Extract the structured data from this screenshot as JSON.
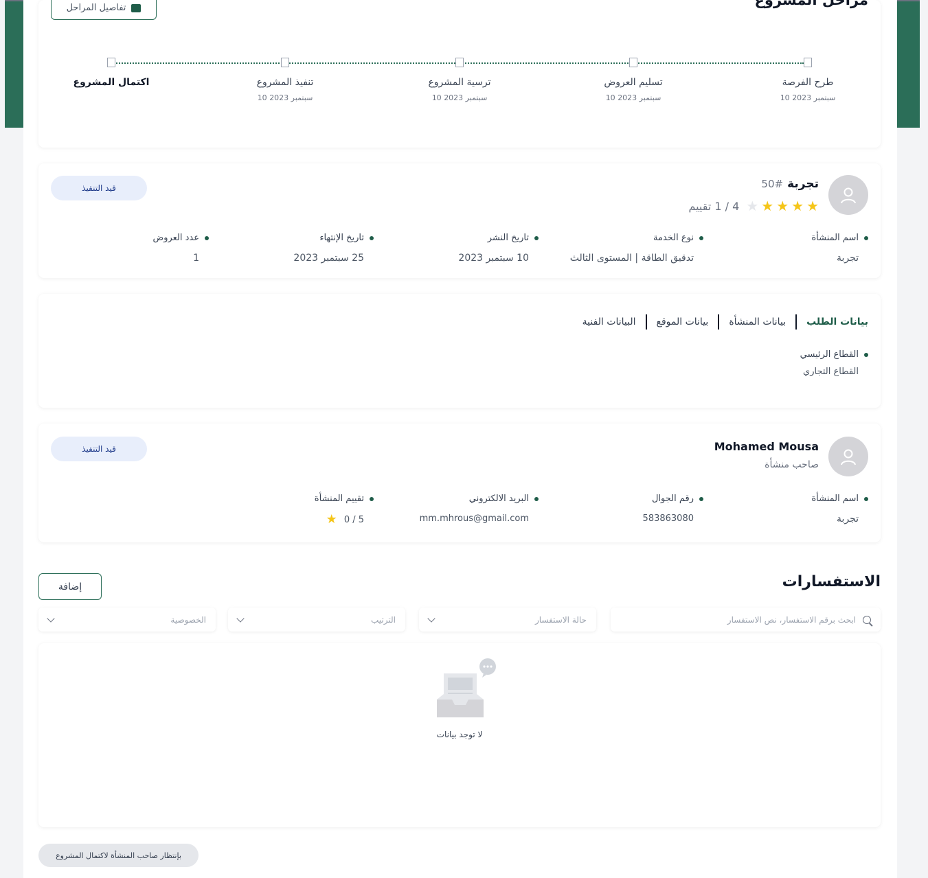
{
  "stages": {
    "title": "مراحل المشروع",
    "details_button": "تفاصيل المراحل",
    "items": [
      {
        "name": "طرح الفرصة",
        "date": "10 سبتمبر 2023"
      },
      {
        "name": "تسليم العروض",
        "date": "10 سبتمبر 2023"
      },
      {
        "name": "ترسية المشروع",
        "date": "10 سبتمبر 2023"
      },
      {
        "name": "تنفيذ المشروع",
        "date": "10 سبتمبر 2023"
      },
      {
        "name": "اكتمال المشروع",
        "date": ""
      }
    ]
  },
  "project": {
    "name": "تجربة",
    "number": "#50",
    "rating": 4,
    "rating_text": "4 / 1 تقييم",
    "status": "قيد التنفيذ",
    "fields": [
      {
        "label": "اسم المنشأة",
        "value": "تجربة"
      },
      {
        "label": "نوع الخدمة",
        "value": "تدقيق الطاقة | المستوى الثالث"
      },
      {
        "label": "تاريخ النشر",
        "value": "10 سبتمبر 2023"
      },
      {
        "label": "تاريخ الإنتهاء",
        "value": "25 سبتمبر 2023"
      },
      {
        "label": "عدد العروض",
        "value": "1"
      }
    ]
  },
  "tabs": {
    "items": [
      "بيانات الطلب",
      "بيانات المنشأة",
      "بيانات الموقع",
      "البيانات الفنية"
    ],
    "active": 0,
    "sector_label": "القطاع الرئيسي",
    "sector_value": "القطاع التجاري"
  },
  "owner": {
    "name": "Mohamed Mousa",
    "role": "صاحب منشأة",
    "status": "قيد التنفيذ",
    "fields": [
      {
        "label": "اسم المنشأة",
        "value": "تجربة"
      },
      {
        "label": "رقم الجوال",
        "value": "583863080"
      },
      {
        "label": "البريد الالكتروني",
        "value": "mm.mhrous@gmail.com"
      },
      {
        "label": "تقييم المنشأة",
        "value": "0 / 5"
      }
    ]
  },
  "inquiries": {
    "title": "الاستفسارات",
    "add_button": "إضافة",
    "search_placeholder": "ابحث برقم الاستفسار، نص الاستفسار",
    "filters": [
      "حالة الاستفسار",
      "الترتيب",
      "الخصوصية"
    ],
    "empty_text": "لا توجد بيانات"
  },
  "footer": {
    "waiting_text": "بإنتظار صاحب المنشأة لاكتمال المشروع"
  },
  "colors": {
    "brand_green": "#2b6e58",
    "star": "#f5c518",
    "badge_bg": "#e8eefb"
  }
}
